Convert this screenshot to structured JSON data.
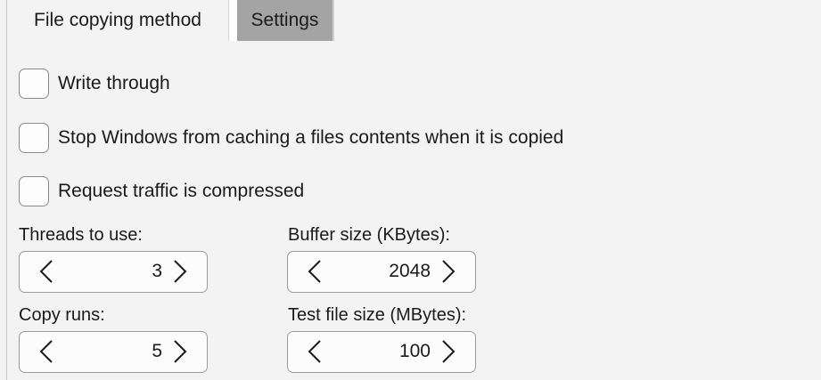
{
  "tabs": {
    "method": "File copying method",
    "settings": "Settings"
  },
  "options": {
    "write_through": {
      "label": "Write through",
      "checked": false
    },
    "stop_caching": {
      "label": "Stop Windows from caching a files contents when it is copied",
      "checked": false
    },
    "compressed": {
      "label": "Request traffic is compressed",
      "checked": false
    }
  },
  "fields": {
    "threads": {
      "label": "Threads to use:",
      "value": "3"
    },
    "buffer": {
      "label": "Buffer size (KBytes):",
      "value": "2048"
    },
    "runs": {
      "label": "Copy runs:",
      "value": "5"
    },
    "test_size": {
      "label": "Test file size (MBytes):",
      "value": "100"
    }
  },
  "icons": {
    "decrement": "chevron-left-icon",
    "increment": "chevron-right-icon"
  },
  "colors": {
    "selected_tab": "#a4a4a4",
    "background": "#f3f3f3"
  }
}
